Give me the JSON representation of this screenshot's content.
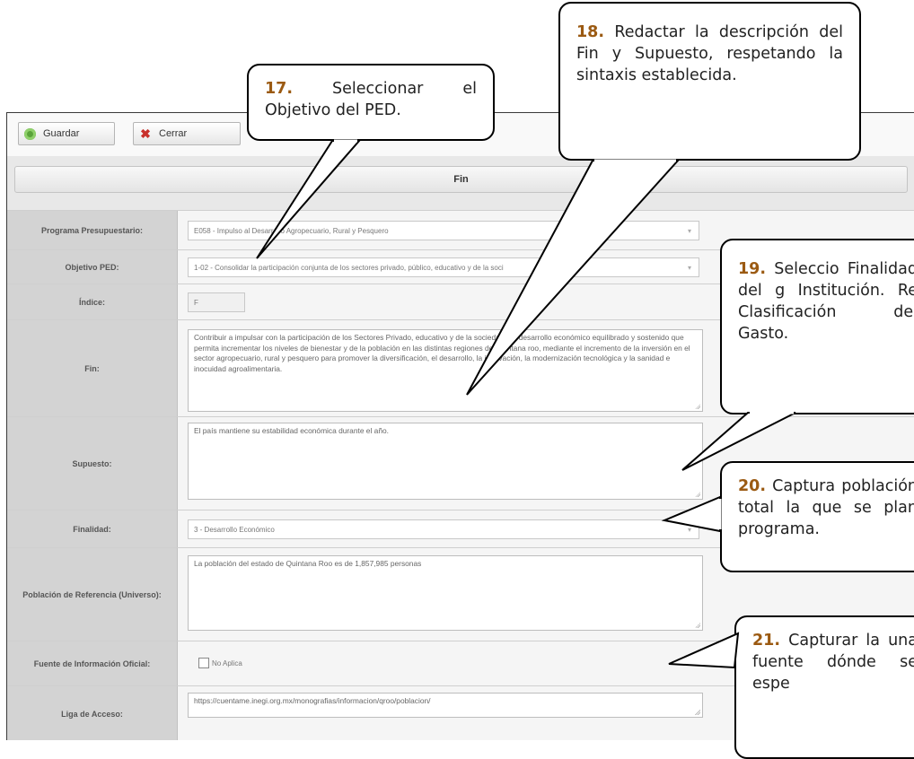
{
  "toolbar": {
    "save_label": "Guardar",
    "close_label": "Cerrar"
  },
  "section": {
    "title": "Fin"
  },
  "fields": {
    "programa": {
      "label": "Programa Presupuestario:",
      "value": "E058 - Impulso al Desarrollo Agropecuario, Rural y Pesquero"
    },
    "objetivo": {
      "label": "Objetivo PED:",
      "value": "1-02 - Consolidar la participación conjunta de los sectores privado, público, educativo y de la soci"
    },
    "indice": {
      "label": "Índice:",
      "value": "F"
    },
    "fin": {
      "label": "Fin:",
      "value": "Contribuir a impulsar con la participación de los Sectores Privado, educativo y de la sociedad, un desarrollo económico equilibrado y sostenido que permita incrementar los niveles de bienestar y de la población en las distintas regiones de Quintana roo, mediante el incremento de la inversión en el sector agropecuario, rural y pesquero para promover la diversificación, el desarrollo, la innovación, la modernización tecnológica y la sanidad e inocuidad agroalimentaria."
    },
    "supuesto": {
      "label": "Supuesto:",
      "value": "El país mantiene su estabilidad económica durante el año."
    },
    "finalidad": {
      "label": "Finalidad:",
      "value": "3 - Desarrollo Económico"
    },
    "poblacion": {
      "label": "Población de Referencia (Universo):",
      "value": "La población del estado de Quintana Roo es de 1,857,985 personas"
    },
    "fuente": {
      "label": "Fuente de Información Oficial:",
      "checkbox_label": "No Aplica",
      "checked": false
    },
    "liga": {
      "label": "Liga de Acceso:",
      "value": "https://cuentame.inegi.org.mx/monografias/informacion/qroo/poblacion/"
    }
  },
  "callouts": {
    "c17": {
      "num": "17.",
      "text": "Seleccionar el Objetivo del PED."
    },
    "c18": {
      "num": "18.",
      "text": "Redactar la descripción del Fin y Supuesto, respetando la sintaxis establecida."
    },
    "c19": {
      "num": "19.",
      "text": "Seleccio Finalidad del g Institución. Re Clasificación del Gasto."
    },
    "c20": {
      "num": "20.",
      "text": "Captura población total la que se plan programa."
    },
    "c21": {
      "num": "21.",
      "text": "Capturar la una fuente dónde se espe"
    }
  },
  "colors": {
    "callout_number": "#9b5a12",
    "label_bg": "#d3d3d3",
    "save_icon": "#5aa33a",
    "close_icon": "#c8302b"
  }
}
